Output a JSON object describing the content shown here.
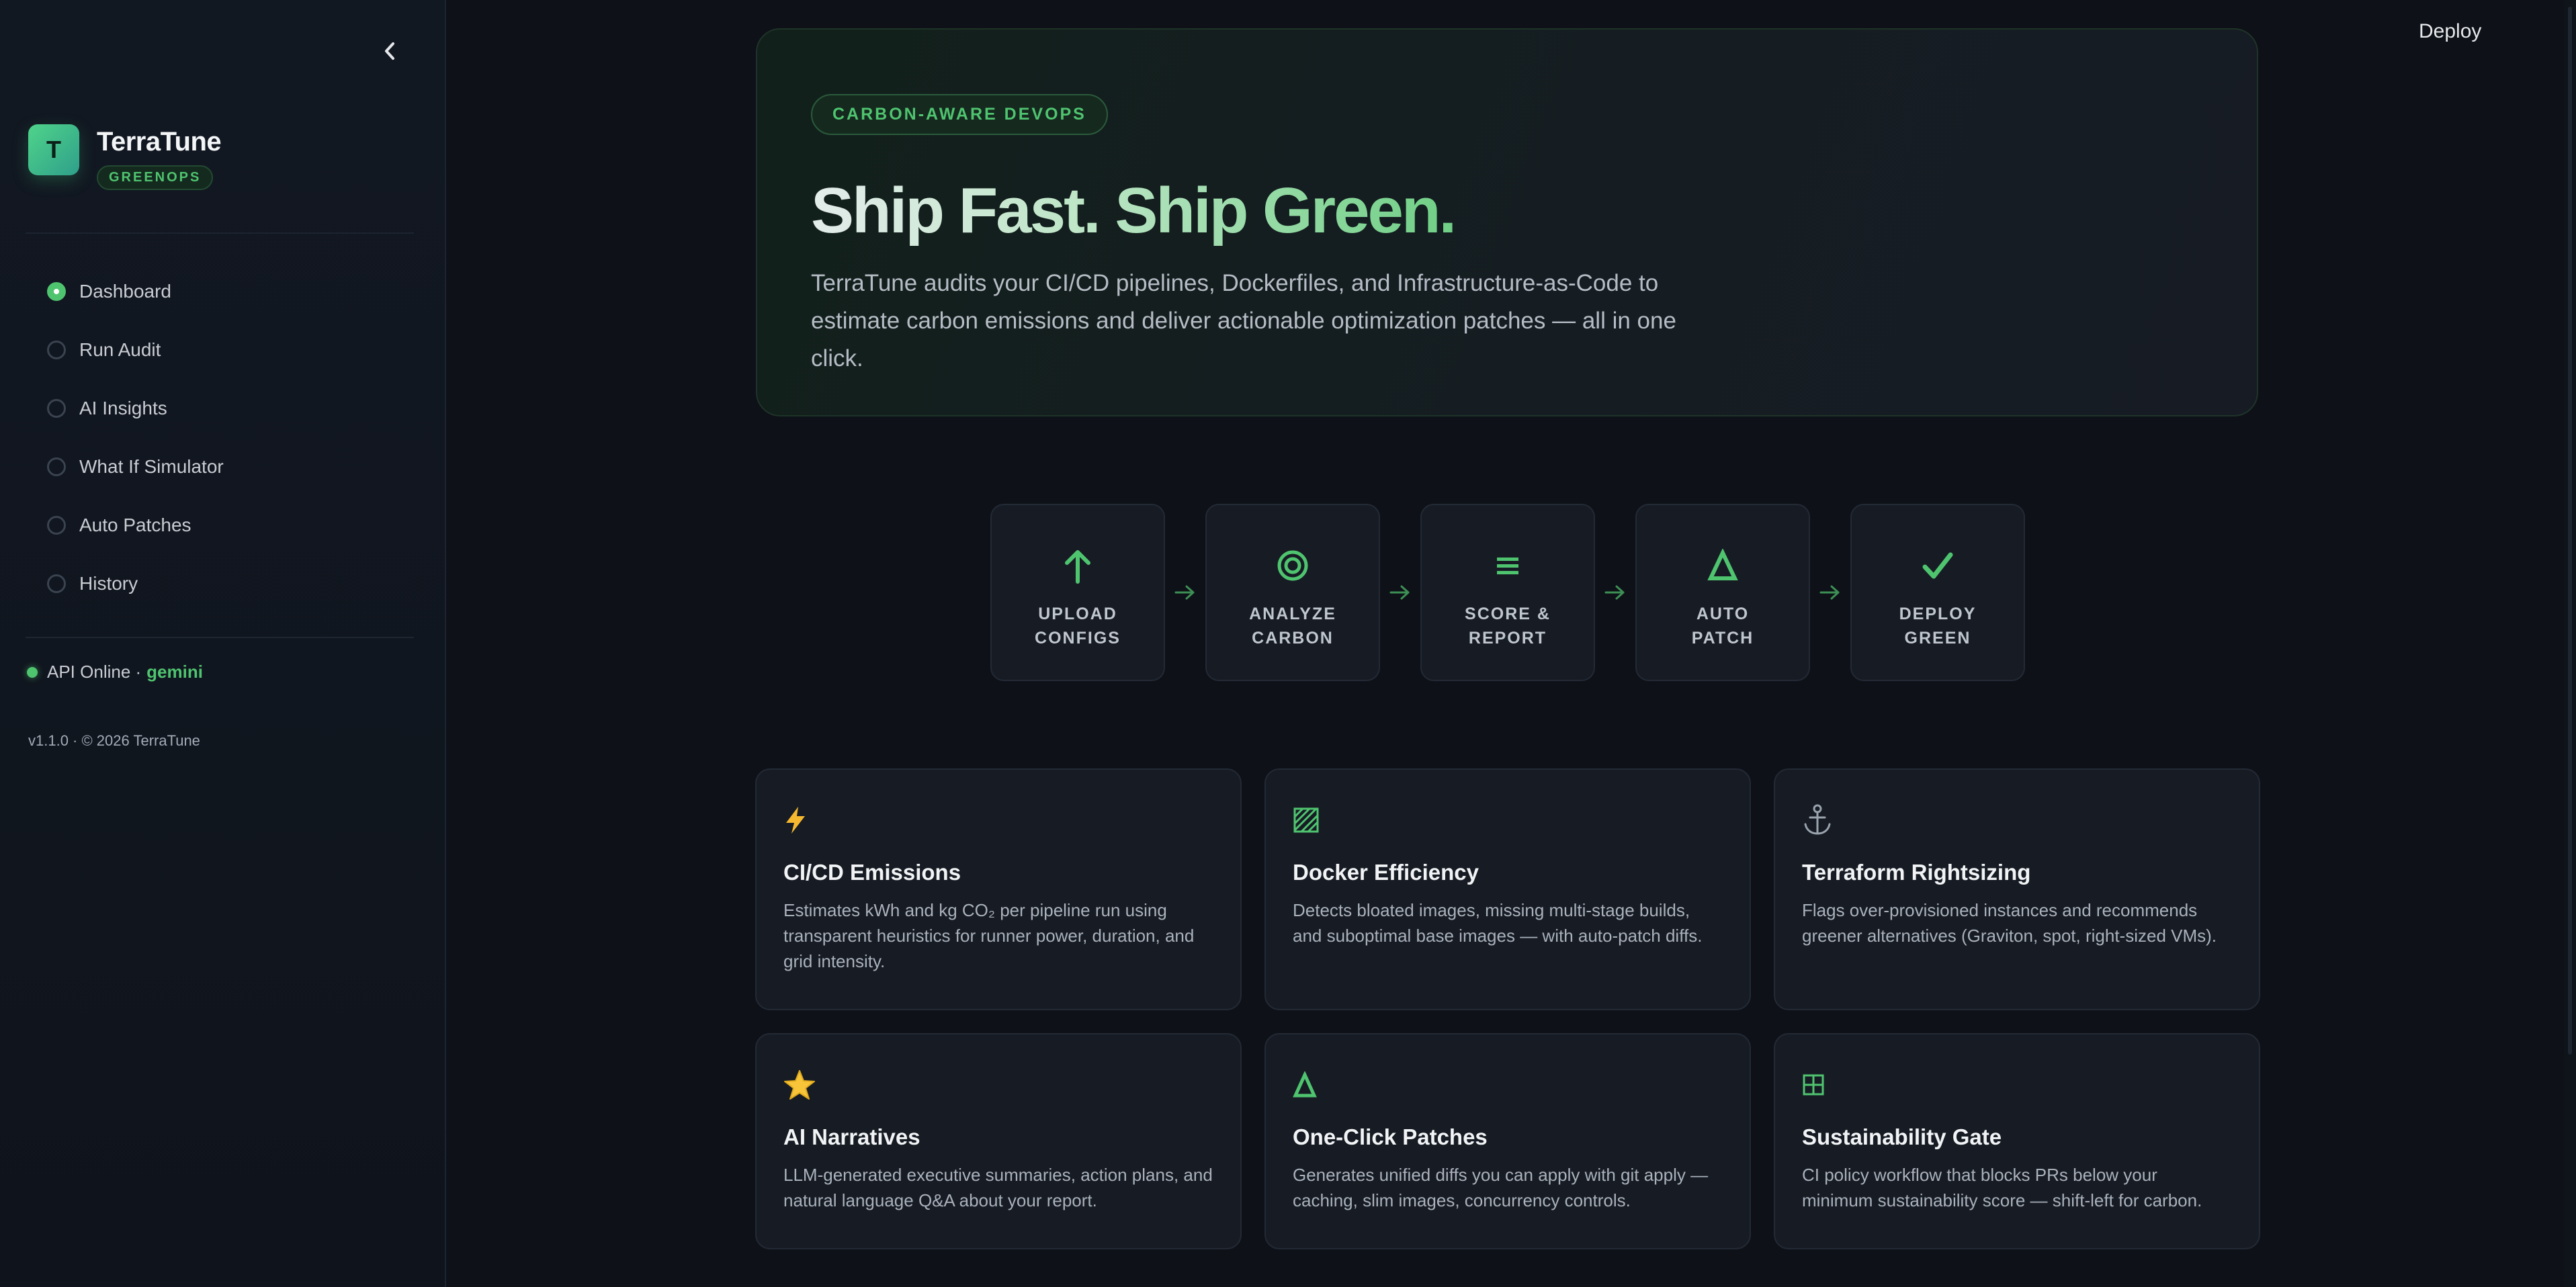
{
  "sidebar": {
    "brand_initial": "T",
    "brand_name": "TerraTune",
    "brand_badge": "GREENOPS",
    "items": [
      {
        "label": "Dashboard",
        "active": true
      },
      {
        "label": "Run Audit",
        "active": false
      },
      {
        "label": "AI Insights",
        "active": false
      },
      {
        "label": "What If Simulator",
        "active": false
      },
      {
        "label": "Auto Patches",
        "active": false
      },
      {
        "label": "History",
        "active": false
      }
    ],
    "api_status": "API Online ·",
    "api_model": "gemini",
    "version": "v1.1.0 · © 2026 TerraTune"
  },
  "header": {
    "deploy_label": "Deploy"
  },
  "hero": {
    "badge": "CARBON-AWARE DEVOPS",
    "title": "Ship Fast. Ship Green.",
    "description": "TerraTune audits your CI/CD pipelines, Dockerfiles, and Infrastructure-as-Code to estimate carbon emissions and deliver actionable optimization patches — all in one click."
  },
  "steps": [
    {
      "icon": "arrow-up-icon",
      "line1": "UPLOAD",
      "line2": "CONFIGS"
    },
    {
      "icon": "target-icon",
      "line1": "ANALYZE",
      "line2": "CARBON"
    },
    {
      "icon": "list-icon",
      "line1": "SCORE &",
      "line2": "REPORT"
    },
    {
      "icon": "delta-icon",
      "line1": "AUTO",
      "line2": "PATCH"
    },
    {
      "icon": "check-icon",
      "line1": "DEPLOY",
      "line2": "GREEN"
    }
  ],
  "cards": [
    {
      "icon": "lightning-icon",
      "title": "CI/CD Emissions",
      "desc": "Estimates kWh and kg CO₂ per pipeline run using transparent heuristics for runner power, duration, and grid intensity."
    },
    {
      "icon": "hatched-square-icon",
      "title": "Docker Efficiency",
      "desc": "Detects bloated images, missing multi-stage builds, and suboptimal base images — with auto-patch diffs."
    },
    {
      "icon": "anchor-icon",
      "title": "Terraform Rightsizing",
      "desc": "Flags over-provisioned instances and recommends greener alternatives (Graviton, spot, right-sized VMs)."
    },
    {
      "icon": "star-icon",
      "title": "AI Narratives",
      "desc": "LLM-generated executive summaries, action plans, and natural language Q&A about your report."
    },
    {
      "icon": "delta-icon",
      "title": "One-Click Patches",
      "desc": "Generates unified diffs you can apply with git apply — caching, slim images, concurrency controls."
    },
    {
      "icon": "grid-square-icon",
      "title": "Sustainability Gate",
      "desc": "CI policy workflow that blocks PRs below your minimum sustainability score — shift-left for carbon."
    }
  ],
  "colors": {
    "accent": "#4fc46f",
    "background": "#0e1117",
    "card": "#171c24"
  }
}
